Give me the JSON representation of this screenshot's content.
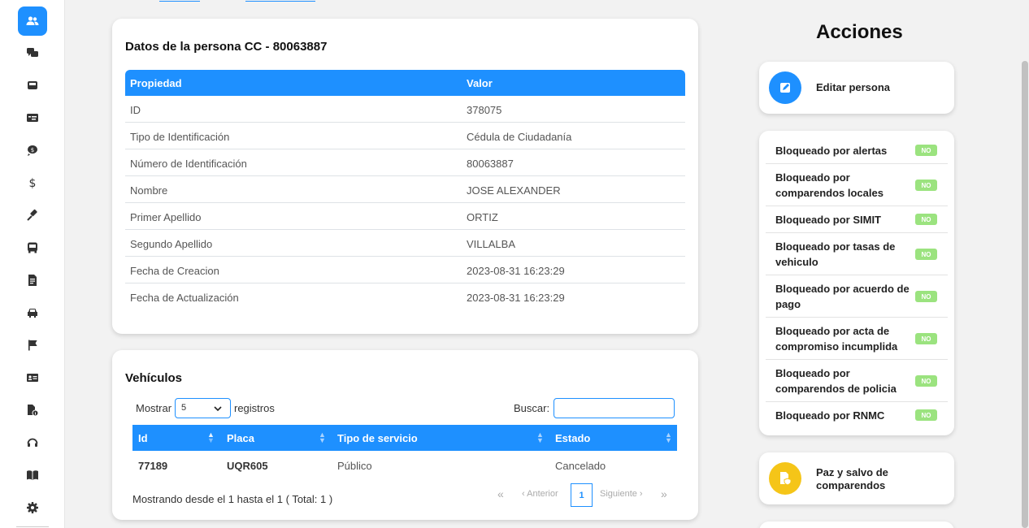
{
  "sidebar": {
    "items": [
      {
        "icon": "users-icon",
        "active": true
      },
      {
        "icon": "chat-icon"
      },
      {
        "icon": "inbox-icon"
      },
      {
        "icon": "id-card-icon"
      },
      {
        "icon": "coin-icon"
      },
      {
        "icon": "dollar-icon"
      },
      {
        "icon": "gavel-icon"
      },
      {
        "icon": "bus-icon"
      },
      {
        "icon": "document-icon"
      },
      {
        "icon": "car-icon"
      },
      {
        "icon": "flag-icon"
      },
      {
        "icon": "address-card-icon"
      },
      {
        "icon": "file-info-icon"
      },
      {
        "icon": "headset-icon"
      },
      {
        "icon": "book-icon"
      },
      {
        "icon": "gear-icon"
      }
    ]
  },
  "person_card": {
    "title": "Datos de la persona CC - 80063887",
    "col_property": "Propiedad",
    "col_value": "Valor",
    "rows": [
      {
        "property": "ID",
        "value": "378075"
      },
      {
        "property": "Tipo de Identificación",
        "value": "Cédula de Ciudadanía"
      },
      {
        "property": "Número de Identificación",
        "value": "80063887"
      },
      {
        "property": "Nombre",
        "value": "JOSE ALEXANDER"
      },
      {
        "property": "Primer Apellido",
        "value": "ORTIZ"
      },
      {
        "property": "Segundo Apellido",
        "value": "VILLALBA"
      },
      {
        "property": "Fecha de Creacion",
        "value": "2023-08-31 16:23:29"
      },
      {
        "property": "Fecha de Actualización",
        "value": "2023-08-31 16:23:29"
      }
    ]
  },
  "vehicles": {
    "title": "Vehículos",
    "show_label": "Mostrar",
    "show_value": "5",
    "records_label": "registros",
    "search_label": "Buscar:",
    "columns": [
      "Id",
      "Placa",
      "Tipo de servicio",
      "Estado"
    ],
    "rows": [
      {
        "id": "77189",
        "placa": "UQR605",
        "tipo": "Público",
        "estado": "Cancelado"
      }
    ],
    "summary": "Mostrando desde el 1 hasta el 1 ( Total: 1 )",
    "pager": {
      "first": "«",
      "prev": "‹ Anterior",
      "page": "1",
      "next": "Siguiente ›",
      "last": "»"
    }
  },
  "actions": {
    "title": "Acciones",
    "edit_label": "Editar persona",
    "paz_label_1": "Paz y salvo de",
    "paz_label_2": "comparendos",
    "blocks": [
      {
        "label": "Bloqueado por alertas",
        "status": "NO"
      },
      {
        "label": "Bloqueado por comparendos locales",
        "status": "NO"
      },
      {
        "label": "Bloqueado por SIMIT",
        "status": "NO"
      },
      {
        "label": "Bloqueado por tasas de vehiculo",
        "status": "NO"
      },
      {
        "label": "Bloqueado por acuerdo de pago",
        "status": "NO"
      },
      {
        "label": "Bloqueado por acta de compromiso incumplida",
        "status": "NO"
      },
      {
        "label": "Bloqueado por comparendos de policia",
        "status": "NO"
      },
      {
        "label": "Bloqueado por RNMC",
        "status": "NO"
      }
    ]
  },
  "colors": {
    "primary": "#1e90ff",
    "badge": "#9be37f",
    "paz": "#f5c518"
  }
}
